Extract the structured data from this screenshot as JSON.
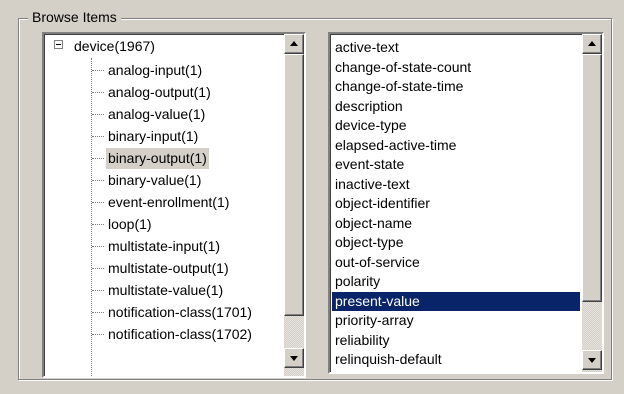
{
  "groupbox": {
    "title": "Browse Items"
  },
  "tree": {
    "root": {
      "expander": "-",
      "label": "device(1967)"
    },
    "items": [
      {
        "label": "analog-input(1)"
      },
      {
        "label": "analog-output(1)"
      },
      {
        "label": "analog-value(1)"
      },
      {
        "label": "binary-input(1)"
      },
      {
        "label": "binary-output(1)"
      },
      {
        "label": "binary-value(1)"
      },
      {
        "label": "event-enrollment(1)"
      },
      {
        "label": "loop(1)"
      },
      {
        "label": "multistate-input(1)"
      },
      {
        "label": "multistate-output(1)"
      },
      {
        "label": "multistate-value(1)"
      },
      {
        "label": "notification-class(1701)"
      },
      {
        "label": "notification-class(1702)"
      }
    ],
    "selected_label": "binary-output(1)"
  },
  "property_list": {
    "items": [
      {
        "label": "active-text"
      },
      {
        "label": "change-of-state-count"
      },
      {
        "label": "change-of-state-time"
      },
      {
        "label": "description"
      },
      {
        "label": "device-type"
      },
      {
        "label": "elapsed-active-time"
      },
      {
        "label": "event-state"
      },
      {
        "label": "inactive-text"
      },
      {
        "label": "object-identifier"
      },
      {
        "label": "object-name"
      },
      {
        "label": "object-type"
      },
      {
        "label": "out-of-service"
      },
      {
        "label": "polarity"
      },
      {
        "label": "present-value"
      },
      {
        "label": "priority-array"
      },
      {
        "label": "reliability"
      },
      {
        "label": "relinquish-default"
      }
    ],
    "selected_label": "present-value"
  },
  "colors": {
    "window_bg": "#d4d0c8",
    "selection_bg": "#0a246a",
    "selection_text": "#ffffff"
  },
  "icons": {
    "tree_expander": "minus-box-icon",
    "scroll_up": "arrow-up-icon",
    "scroll_down": "arrow-down-icon"
  }
}
